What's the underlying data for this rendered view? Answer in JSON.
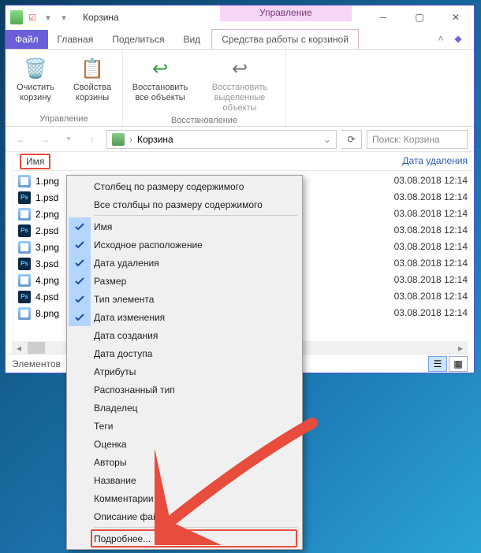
{
  "window": {
    "title": "Корзина",
    "context_tab": "Управление"
  },
  "ribbon": {
    "tabs": [
      "Файл",
      "Главная",
      "Поделиться",
      "Вид"
    ],
    "special_tab": "Средства работы с корзиной",
    "groups": {
      "manage": {
        "title": "Управление",
        "clear": "Очистить корзину",
        "props": "Свойства корзины"
      },
      "restore": {
        "title": "Восстановление",
        "restore_all": "Восстановить все объекты",
        "restore_sel": "Восстановить выделенные объекты"
      }
    }
  },
  "address": {
    "segment": "Корзина",
    "search_placeholder": "Поиск: Корзина"
  },
  "columns": {
    "name": "Имя",
    "deleted": "Дата удаления"
  },
  "files": [
    {
      "name": "1.png",
      "type": "png"
    },
    {
      "name": "1.psd",
      "type": "psd"
    },
    {
      "name": "2.png",
      "type": "png"
    },
    {
      "name": "2.psd",
      "type": "psd"
    },
    {
      "name": "3.png",
      "type": "png"
    },
    {
      "name": "3.psd",
      "type": "psd"
    },
    {
      "name": "4.png",
      "type": "png"
    },
    {
      "name": "4.psd",
      "type": "psd"
    },
    {
      "name": "8.png",
      "type": "png"
    }
  ],
  "dates": [
    "03.08.2018 12:14",
    "03.08.2018 12:14",
    "03.08.2018 12:14",
    "03.08.2018 12:14",
    "03.08.2018 12:14",
    "03.08.2018 12:14",
    "03.08.2018 12:14",
    "03.08.2018 12:14",
    "03.08.2018 12:14"
  ],
  "status": "Элементов",
  "context_menu": {
    "size_one": "Столбец по размеру содержимого",
    "size_all": "Все столбцы по размеру содержимого",
    "items": [
      {
        "label": "Имя",
        "checked": true
      },
      {
        "label": "Исходное расположение",
        "checked": true
      },
      {
        "label": "Дата удаления",
        "checked": true
      },
      {
        "label": "Размер",
        "checked": true
      },
      {
        "label": "Тип элемента",
        "checked": true
      },
      {
        "label": "Дата изменения",
        "checked": true
      },
      {
        "label": "Дата создания",
        "checked": false
      },
      {
        "label": "Дата доступа",
        "checked": false
      },
      {
        "label": "Атрибуты",
        "checked": false
      },
      {
        "label": "Распознанный тип",
        "checked": false
      },
      {
        "label": "Владелец",
        "checked": false
      },
      {
        "label": "Теги",
        "checked": false
      },
      {
        "label": "Оценка",
        "checked": false
      },
      {
        "label": "Авторы",
        "checked": false
      },
      {
        "label": "Название",
        "checked": false
      },
      {
        "label": "Комментарии",
        "checked": false
      },
      {
        "label": "Описание файла",
        "checked": false
      }
    ],
    "more": "Подробнее..."
  }
}
